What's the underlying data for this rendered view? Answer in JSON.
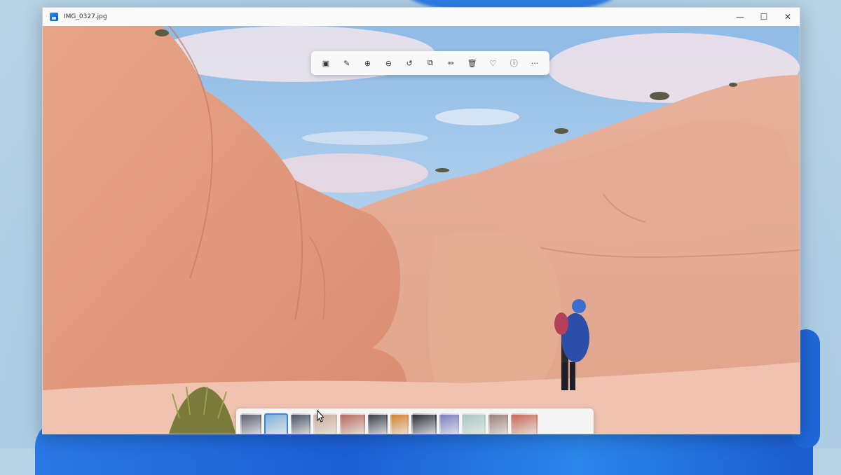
{
  "window": {
    "title": "IMG_0327.jpg",
    "controls": {
      "minimize": "—",
      "maximize": "☐",
      "close": "✕"
    }
  },
  "toolbar": {
    "items": [
      {
        "name": "view-original-icon",
        "glyph": "▣"
      },
      {
        "name": "edit-image-icon",
        "glyph": "✎"
      },
      {
        "name": "zoom-in-icon",
        "glyph": "⊕"
      },
      {
        "name": "zoom-out-icon",
        "glyph": "⊖"
      },
      {
        "name": "rotate-icon",
        "glyph": "↺"
      },
      {
        "name": "crop-icon",
        "glyph": "⧉"
      },
      {
        "name": "draw-icon",
        "glyph": "✏"
      },
      {
        "name": "delete-icon",
        "glyph": "🗑"
      },
      {
        "name": "favorite-icon",
        "glyph": "♡"
      },
      {
        "name": "info-icon",
        "glyph": "ⓘ"
      },
      {
        "name": "more-icon",
        "glyph": "···"
      }
    ]
  },
  "filmstrip": {
    "thumbnails": [
      {
        "color": "#5b6070",
        "selected": false
      },
      {
        "color": "#7fb2d8",
        "selected": true
      },
      {
        "color": "#4a5566",
        "selected": false
      },
      {
        "color": "#c9a896",
        "selected": false
      },
      {
        "color": "#b86a5a",
        "selected": false
      },
      {
        "color": "#3a3f4a",
        "selected": false
      },
      {
        "color": "#d6822f",
        "selected": false
      },
      {
        "color": "#2c2f3a",
        "selected": false
      },
      {
        "color": "#7a7ec2",
        "selected": false
      },
      {
        "color": "#a7c9c0",
        "selected": false
      },
      {
        "color": "#9a7f78",
        "selected": false
      },
      {
        "color": "#c86a54",
        "selected": false
      }
    ]
  },
  "colors": {
    "accent": "#2f86e8",
    "rock": "#e5a88c",
    "sky": "#9cc6ea"
  }
}
